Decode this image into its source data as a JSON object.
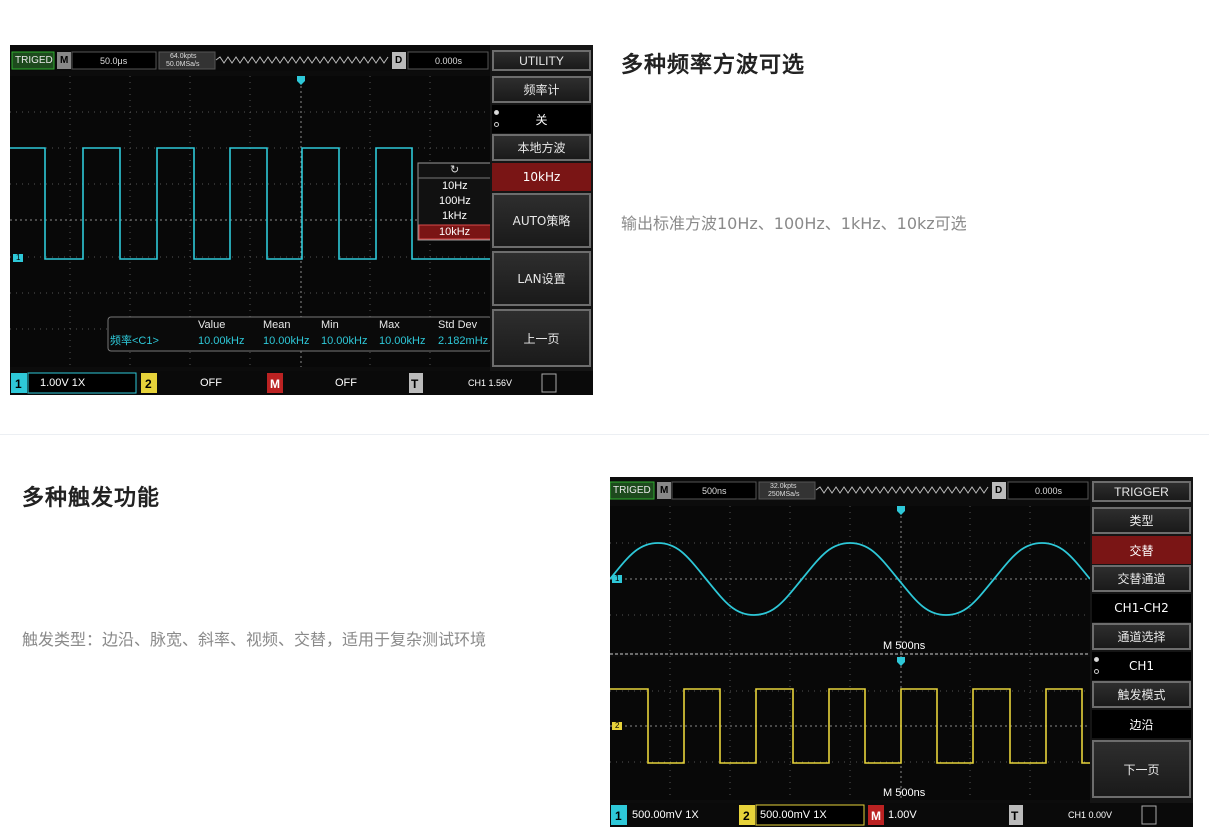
{
  "section1": {
    "heading": "多种频率方波可选",
    "description": "输出标准方波10Hz、100Hz、1kHz、10kz可选"
  },
  "section2": {
    "heading": "多种触发功能",
    "description": "触发类型：边沿、脉宽、斜率、视频、交替，适用于复杂测试环境"
  },
  "scope1": {
    "status": "TRIGED",
    "mode_label": "M",
    "timebase": "50.0μs",
    "mem_depth": "64.0kpts",
    "sample_rate": "50.0MSa/s",
    "delay_label": "D",
    "delay": "0.000s",
    "menu_title": "UTILITY",
    "menu": [
      {
        "label": "频率计",
        "value": "关",
        "dots": true
      },
      {
        "label": "本地方波",
        "value": "10kHz",
        "selected": true
      },
      {
        "label": "AUTO策略"
      },
      {
        "label": "LAN设置"
      },
      {
        "label": "上一页"
      }
    ],
    "popup": {
      "icon": "↻",
      "options": [
        "10Hz",
        "100Hz",
        "1kHz",
        "10kHz"
      ],
      "selected": "10kHz"
    },
    "measure": {
      "headers": [
        "Value",
        "Mean",
        "Min",
        "Max",
        "Std Dev"
      ],
      "row_label": "频率<C1>",
      "values": [
        "10.00kHz",
        "10.00kHz",
        "10.00kHz",
        "10.00kHz",
        "2.182mHz"
      ]
    },
    "bottom": {
      "ch1_num": "1",
      "ch1_text": "1.00V  1X",
      "ch2_num": "2",
      "ch2_text": "OFF",
      "math_label": "M",
      "math_text": "OFF",
      "trig_label": "T",
      "trig_text": "CH1  1.56V"
    },
    "ch1_marker": "1",
    "colors": {
      "ch1": "#2ec8d8",
      "ch2": "#e6d23a",
      "selected": "#7a1515"
    }
  },
  "scope2": {
    "status": "TRIGED",
    "mode_label": "M",
    "timebase": "500ns",
    "mem_depth": "32.0kpts",
    "sample_rate": "250MSa/s",
    "delay_label": "D",
    "delay": "0.000s",
    "menu_title": "TRIGGER",
    "menu": [
      {
        "label": "类型",
        "value": "交替",
        "selected": true
      },
      {
        "label": "交替通道",
        "value": "CH1-CH2"
      },
      {
        "label": "通道选择",
        "value": "CH1",
        "dots": true
      },
      {
        "label": "触发模式",
        "value": "边沿"
      },
      {
        "label": "下一页"
      }
    ],
    "upper_timebase": "M 500ns",
    "lower_timebase": "M 500ns",
    "bottom": {
      "ch1_num": "1",
      "ch1_text": "500.00mV  1X",
      "ch2_num": "2",
      "ch2_text": "500.00mV  1X",
      "math_label": "M",
      "math_text": "1.00V",
      "trig_label": "T",
      "trig_text": "CH1  0.00V"
    },
    "ch1_marker": "1",
    "ch2_marker": "2"
  }
}
